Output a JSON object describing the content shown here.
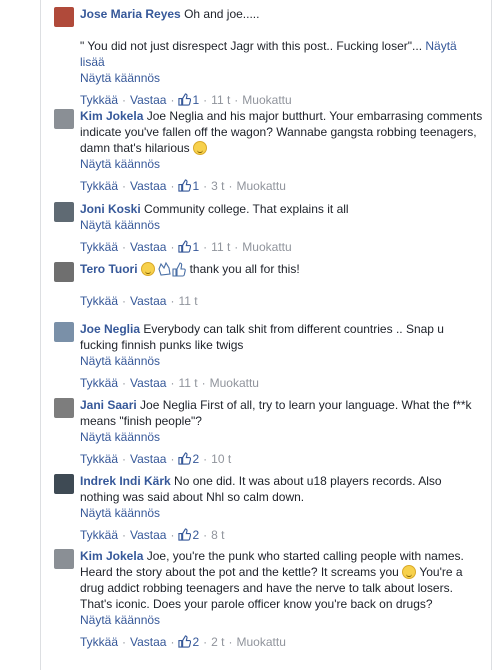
{
  "actions": {
    "like": "Tykkää",
    "reply": "Vastaa",
    "translate": "Näytä käännös"
  },
  "comments": [
    {
      "author": "Jose Maria Reyes",
      "text_lines": [
        "Oh and joe....."
      ],
      "quote": "\" You did not just disrespect Jagr with this post.. Fucking loser\"...",
      "see_more": "Näytä lisää",
      "likes": "1",
      "time": "11 t",
      "edited": "Muokattu",
      "avatar_color": "#b04a3a"
    },
    {
      "author": "Kim Jokela",
      "text": "Joe Neglia and his major butthurt. Your embarrasing comments indicate you've fallen off the wagon? Wannabe gangsta robbing teenagers, damn that's hilarious",
      "likes": "1",
      "time": "3 t",
      "edited": "Muokattu",
      "avatar_color": "#8a8f95"
    },
    {
      "author": "Joni Koski",
      "text": "Community college. That explains it all",
      "likes": "1",
      "time": "11 t",
      "edited": "Muokattu",
      "avatar_color": "#5f6a73"
    },
    {
      "author": "Tero Tuori",
      "text": "thank you all for this!",
      "likes": "",
      "time": "11 t",
      "edited": "",
      "avatar_color": "#6f6f6f"
    },
    {
      "author": "Joe Neglia",
      "text": "Everybody can talk shit from different countries .. Snap u fucking finnish punks like twigs",
      "likes": "",
      "time": "11 t",
      "edited": "Muokattu",
      "avatar_color": "#7a90a8"
    },
    {
      "author": "Jani Saari",
      "text": "Joe Neglia First of all, try to learn your language. What the f**k means \"finish people\"?",
      "likes": "2",
      "time": "10 t",
      "edited": "",
      "avatar_color": "#7d7d7d"
    },
    {
      "author": "Indrek Indi Kärk",
      "text": "No one did. It was about u18 players records. Also nothing was said about Nhl so calm down.",
      "likes": "2",
      "time": "8 t",
      "edited": "",
      "avatar_color": "#3e4a54"
    },
    {
      "author": "Kim Jokela",
      "text_a": "Joe, you're the punk who started calling people with names. Heard the story about the pot and the kettle? It screams you",
      "text_b": "You're a drug addict robbing teenagers and have the nerve to talk about losers. That's iconic. Does your parole officer know you're back on drugs?",
      "likes": "2",
      "time": "2 t",
      "edited": "Muokattu",
      "avatar_color": "#8a8f95"
    }
  ]
}
